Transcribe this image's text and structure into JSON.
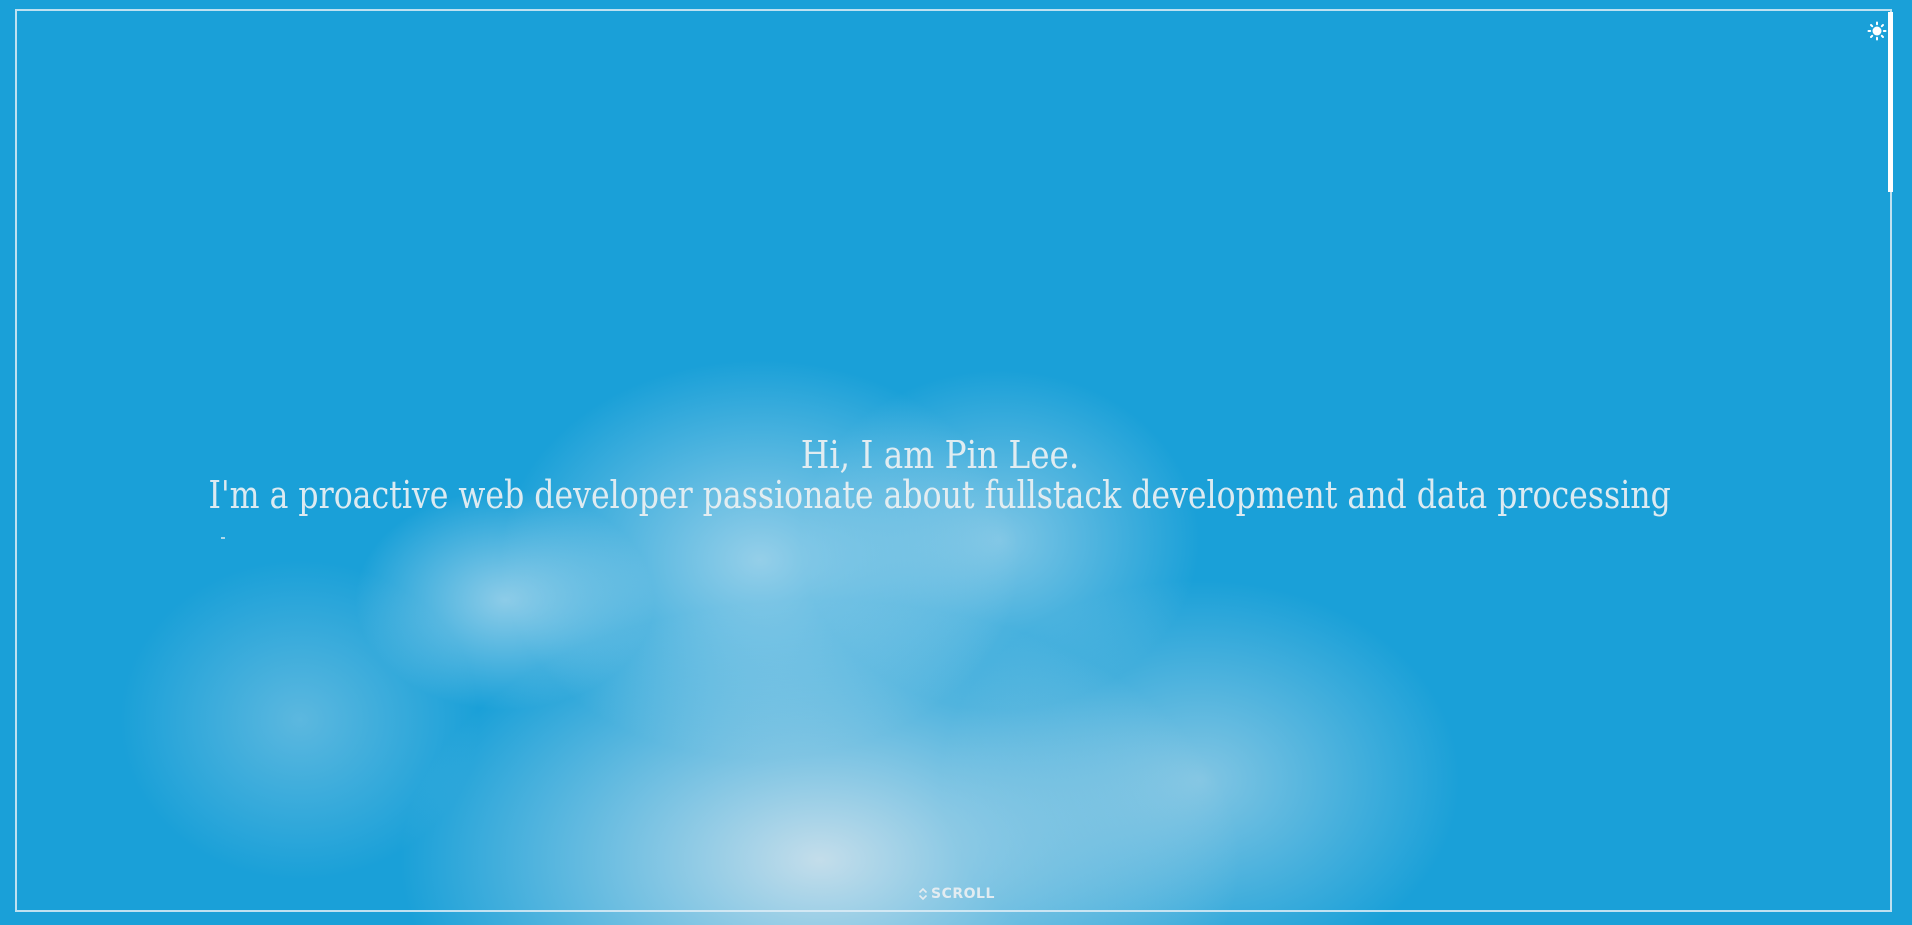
{
  "theme_toggle": {
    "icon": "sun-icon"
  },
  "hero": {
    "title": "Hi, I am Pin Lee.",
    "subtitle": "I'm a proactive web developer passionate about fullstack development and data processing"
  },
  "scroll_hint": {
    "icon": "up-down-chevron-icon",
    "label": "SCROLL"
  },
  "colors": {
    "background": "#1aa0d8",
    "text": "#ecf0f2",
    "frame": "#dcecf6"
  }
}
